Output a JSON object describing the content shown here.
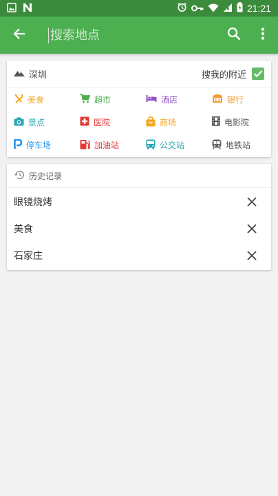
{
  "status_bar": {
    "time": "21:21",
    "icons": [
      "image-icon",
      "n-icon",
      "alarm-icon",
      "key-icon",
      "wifi-icon",
      "signal-icon",
      "battery-icon"
    ]
  },
  "toolbar": {
    "search_placeholder": "搜索地点",
    "color": "#4caf50",
    "icons": [
      "back-arrow-icon",
      "search-icon",
      "more-vert-icon"
    ]
  },
  "location_card": {
    "city": "深圳",
    "nearby_label": "搜我的附近",
    "nearby_checked": true,
    "categories": [
      {
        "label": "美食",
        "icon": "fork-knife-icon",
        "color": "#f5a623"
      },
      {
        "label": "超市",
        "icon": "cart-icon",
        "color": "#4caf50"
      },
      {
        "label": "酒店",
        "icon": "bed-icon",
        "color": "#8e4fc4"
      },
      {
        "label": "银行",
        "icon": "bank-icon",
        "color": "#f39c34"
      },
      {
        "label": "景点",
        "icon": "camera-icon",
        "color": "#26a6b3"
      },
      {
        "label": "医院",
        "icon": "hospital-icon",
        "color": "#e53935"
      },
      {
        "label": "商场",
        "icon": "shopping-bag-icon",
        "color": "#f5a623"
      },
      {
        "label": "电影院",
        "icon": "film-icon",
        "color": "#555555"
      },
      {
        "label": "停车场",
        "icon": "parking-icon",
        "color": "#2196f3"
      },
      {
        "label": "加油站",
        "icon": "gas-station-icon",
        "color": "#e53935"
      },
      {
        "label": "公交站",
        "icon": "bus-icon",
        "color": "#26a6b3"
      },
      {
        "label": "地铁站",
        "icon": "subway-icon",
        "color": "#666666"
      }
    ]
  },
  "history": {
    "title": "历史记录",
    "items": [
      "眼镜烧烤",
      "美食",
      "石家庄"
    ]
  }
}
